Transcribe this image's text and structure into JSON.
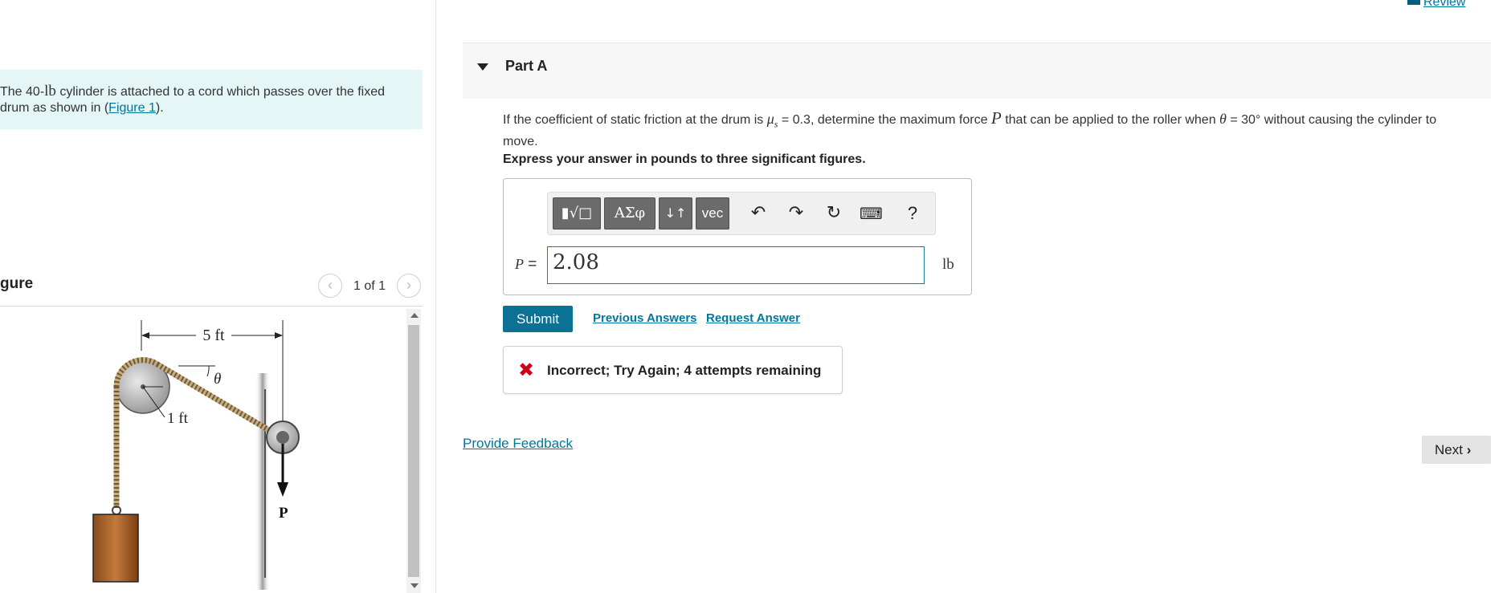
{
  "header": {
    "review_label": "Review"
  },
  "intro": {
    "text_before": "The 40-",
    "weight_unit": "lb",
    "text_middle": " cylinder is attached to a cord which passes over the fixed drum as shown in (",
    "figure_link": "Figure 1",
    "text_after": ")."
  },
  "figure": {
    "title": "gure",
    "count": "1 of 1",
    "prev_icon": "chevron-left",
    "next_icon": "chevron-right",
    "labels": {
      "span": "5 ft",
      "radius": "1 ft",
      "angle": "θ",
      "force": "P"
    }
  },
  "part": {
    "title": "Part A",
    "question_1": "If the coefficient of static friction at the drum is ",
    "mu_symbol": "μ",
    "mu_sub": "s",
    "mu_value": " = 0.3, determine the maximum force ",
    "P_symbol": "P",
    "question_2": " that can be applied to the roller when ",
    "theta_symbol": "θ",
    "theta_value": " = 30°",
    "question_3": " without causing the cylinder to move.",
    "instruction": "Express your answer in pounds to three significant figures."
  },
  "toolbar": {
    "templates_label": "▮√□",
    "greek_label": "ΑΣφ",
    "arrows_label": "↓↑",
    "vec_label": "vec",
    "undo_icon": "↶",
    "redo_icon": "↷",
    "reset_icon": "↻",
    "keyboard_icon": "⌨",
    "help_label": "?"
  },
  "answer": {
    "variable_label": "P =",
    "value": "2.08",
    "unit": "lb"
  },
  "actions": {
    "submit_label": "Submit",
    "previous_answers_label": "Previous Answers",
    "request_answer_label": "Request Answer"
  },
  "feedback": {
    "icon": "✖",
    "message": "Incorrect; Try Again; 4 attempts remaining"
  },
  "footer": {
    "provide_feedback_label": "Provide Feedback",
    "next_label": "Next"
  },
  "colors": {
    "accent": "#00779e",
    "submit": "#0b7195",
    "error": "#d0021b",
    "intro_bg": "#e5f6f7"
  }
}
